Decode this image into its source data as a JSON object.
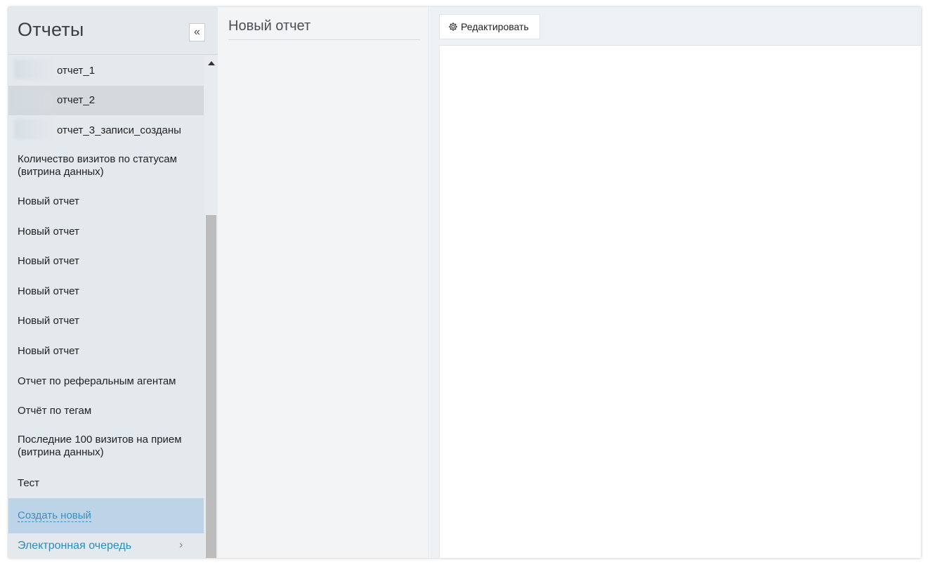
{
  "sidebar": {
    "title": "Отчеты",
    "collapse_label": "«",
    "items": [
      {
        "label": "отчет_1"
      },
      {
        "label": "отчет_2"
      },
      {
        "label": "отчет_3_записи_созданы"
      },
      {
        "label": "Количество визитов по статусам (витрина данных)"
      },
      {
        "label": "Новый отчет"
      },
      {
        "label": "Новый отчет"
      },
      {
        "label": "Новый отчет"
      },
      {
        "label": "Новый отчет"
      },
      {
        "label": "Новый отчет"
      },
      {
        "label": "Новый отчет"
      },
      {
        "label": "Отчет по реферальным агентам"
      },
      {
        "label": "Отчёт по тегам"
      },
      {
        "label": "Последние 100 визитов на прием (витрина данных)"
      },
      {
        "label": "Тест"
      }
    ],
    "create_new": "Создать новый",
    "equeue": "Электронная очередь",
    "equeue_chevron": "›"
  },
  "middle": {
    "title": "Новый отчет"
  },
  "toolbar": {
    "edit_label": "Редактировать",
    "edit_icon": "gear-icon"
  },
  "colors": {
    "sidebar_bg": "#e3e9ed",
    "active_item_bg": "#d3d9dd",
    "create_new_bg": "#bdd3e7",
    "link": "#3a8fc7"
  }
}
